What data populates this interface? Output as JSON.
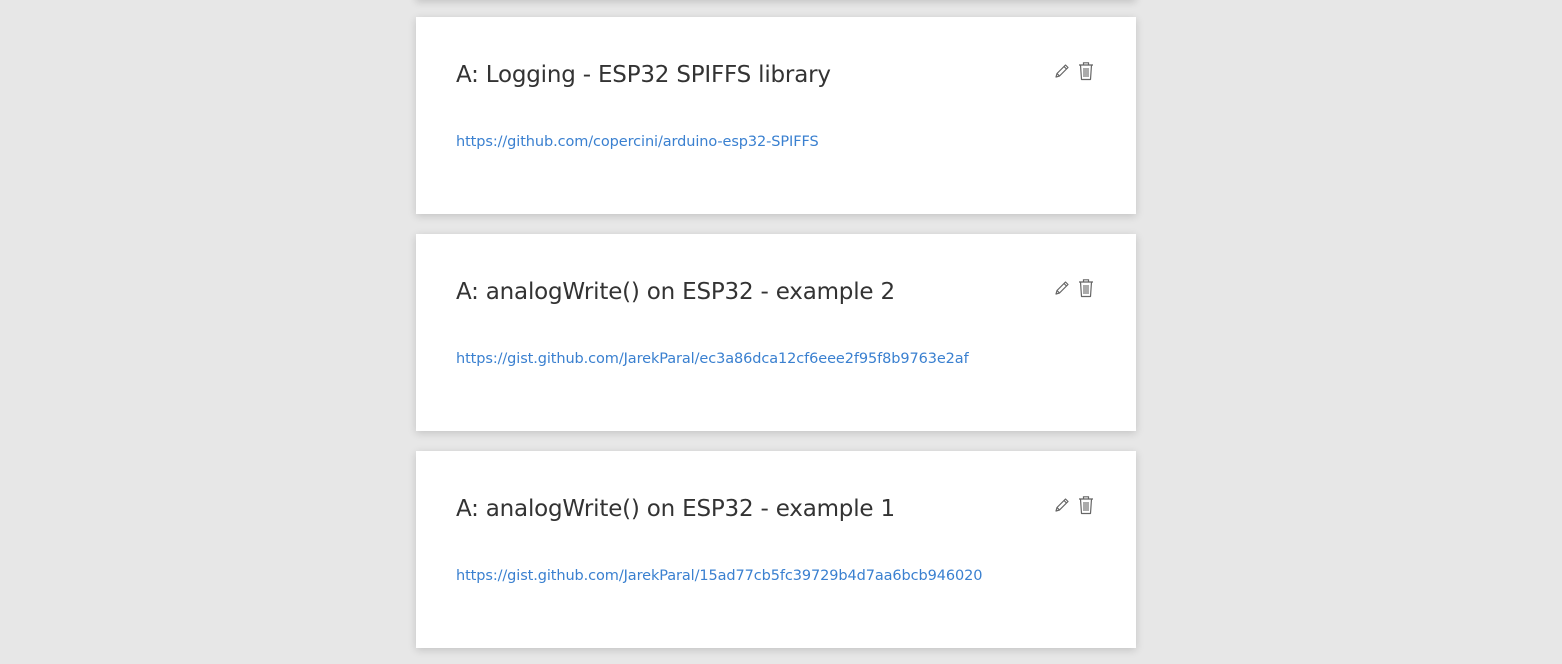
{
  "cards": [
    {
      "title": "A: Logging - ESP32 SPIFFS library",
      "link": "https://github.com/copercini/arduino-esp32-SPIFFS",
      "actions": [
        "pencil-icon",
        "trash-icon"
      ]
    },
    {
      "title": "A: analogWrite() on ESP32 - example 2",
      "link": "https://gist.github.com/JarekParal/ec3a86dca12cf6eee2f95f8b9763e2af",
      "actions": [
        "pencil-icon",
        "trash-icon"
      ]
    },
    {
      "title": "A: analogWrite() on ESP32 - example 1",
      "link": "https://gist.github.com/JarekParal/15ad77cb5fc39729b4d7aa6bcb946020",
      "actions": [
        "pencil-icon",
        "trash-icon"
      ]
    }
  ],
  "colors": {
    "page_background": "#e7e7e7",
    "card_background": "#ffffff",
    "title_text": "#333333",
    "link_text": "#3a80d0",
    "icon_stroke": "#666666"
  }
}
